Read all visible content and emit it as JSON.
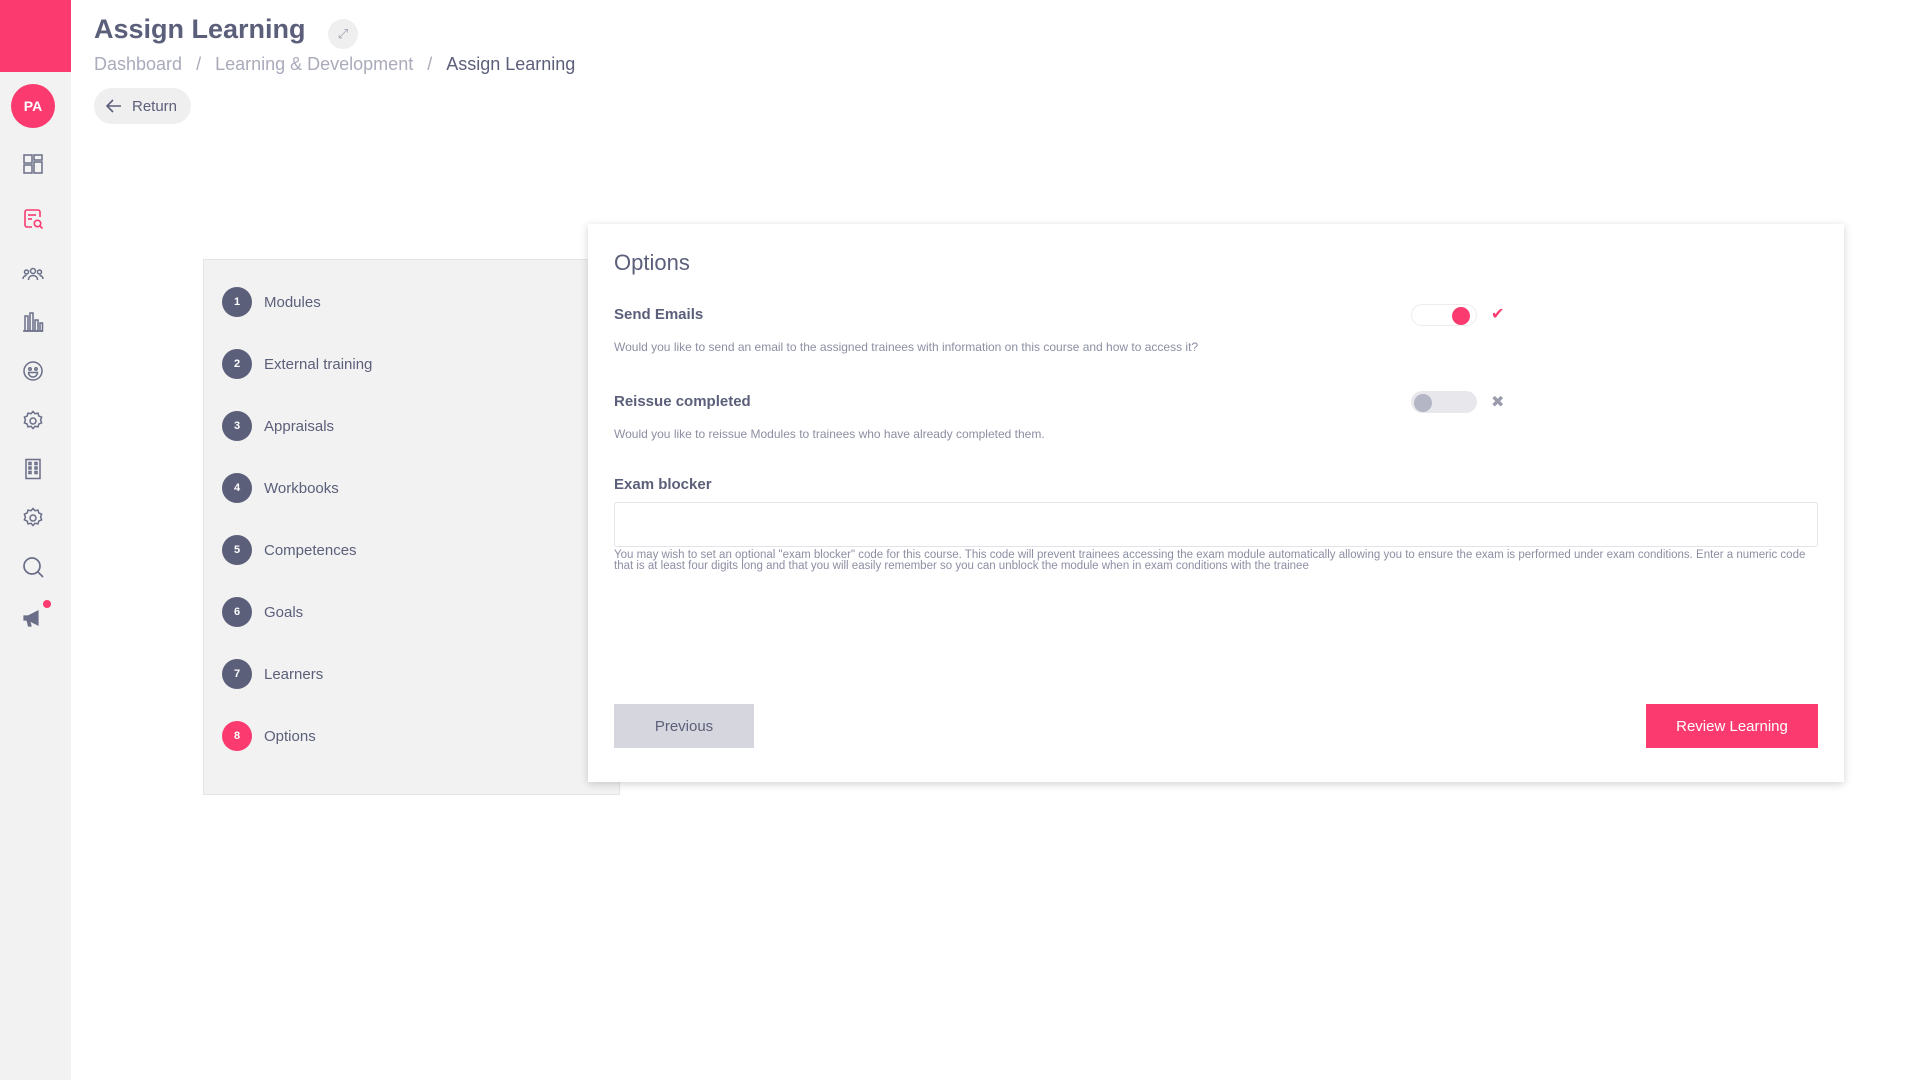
{
  "app": {
    "avatar_initials": "PA",
    "accent_color": "#fb3b6f"
  },
  "header": {
    "title": "Assign Learning",
    "expand_icon": "expand-icon",
    "breadcrumb": [
      "Dashboard",
      "Learning & Development",
      "Assign Learning"
    ],
    "breadcrumb_sep": "/",
    "return_label": "Return"
  },
  "sidebar": {
    "icons": [
      "dashboard-icon",
      "learning-search-icon",
      "people-icon",
      "chart-icon",
      "smiley-icon",
      "gear-icon",
      "building-icon",
      "gear-icon",
      "search-icon",
      "megaphone-icon"
    ]
  },
  "steps": [
    {
      "num": "1",
      "label": "Modules",
      "active": false
    },
    {
      "num": "2",
      "label": "External training",
      "active": false
    },
    {
      "num": "3",
      "label": "Appraisals",
      "active": false
    },
    {
      "num": "4",
      "label": "Workbooks",
      "active": false
    },
    {
      "num": "5",
      "label": "Competences",
      "active": false
    },
    {
      "num": "6",
      "label": "Goals",
      "active": false
    },
    {
      "num": "7",
      "label": "Learners",
      "active": false
    },
    {
      "num": "8",
      "label": "Options",
      "active": true
    }
  ],
  "options": {
    "title": "Options",
    "send_emails": {
      "label": "Send Emails",
      "help": "Would you like to send an email to the assigned trainees with information on this course and how to access it?",
      "enabled": true,
      "mark": "✔"
    },
    "reissue_completed": {
      "label": "Reissue completed",
      "help": "Would you like to reissue Modules to trainees who have already completed them.",
      "enabled": false,
      "mark": "✖"
    },
    "exam_blocker": {
      "label": "Exam blocker",
      "value": "",
      "help": "You may wish to set an optional \"exam blocker\" code for this course. This code will prevent trainees accessing the exam module automatically allowing you to ensure the exam is performed under exam conditions. Enter a numeric code that is at least four digits long and that you will easily remember so you can unblock the module when in exam conditions with the trainee"
    },
    "previous_label": "Previous",
    "review_label": "Review Learning"
  }
}
